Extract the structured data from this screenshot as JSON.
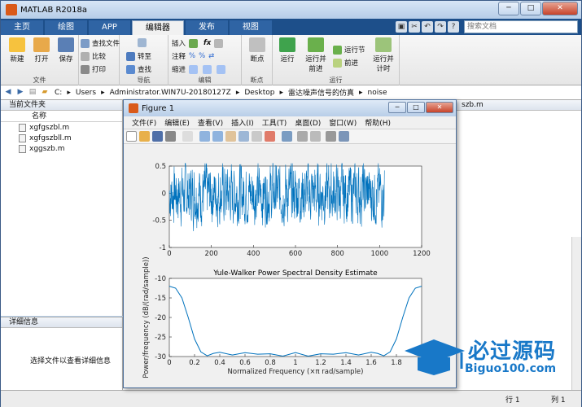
{
  "window": {
    "title": "MATLAB R2018a"
  },
  "tabs": [
    "主页",
    "绘图",
    "APP",
    "编辑器",
    "发布",
    "视图"
  ],
  "search": {
    "placeholder": "搜索文档"
  },
  "toolstrip": {
    "groups": {
      "file": "文件",
      "nav": "导航",
      "edit": "编辑",
      "breakpoints": "断点",
      "run": "运行"
    },
    "new": "新建",
    "open": "打开",
    "save": "保存",
    "find_files": "查找文件",
    "compare": "比较",
    "print": "打印",
    "goto": "转至",
    "find": "查找",
    "insert": "插入",
    "comment": "注释",
    "indent": "缩进",
    "breakpoints": "断点",
    "run": "运行",
    "run_advance": "运行并\n前进",
    "run_section": "运行节",
    "advance": "前进",
    "run_time": "运行并\n计时"
  },
  "address": {
    "parts": [
      "C:",
      "Users",
      "Administrator.WIN7U-20180127Z",
      "Desktop",
      "雷达噪声信号的仿真",
      "noise"
    ]
  },
  "current_folder": {
    "title": "当前文件夹",
    "column": "名称",
    "files": [
      "xgfgszbl.m",
      "xgfgszbll.m",
      "xggszb.m"
    ]
  },
  "details": {
    "title": "详细信息",
    "empty_text": "选择文件以查看详细信息"
  },
  "right_panel": {
    "title": "szb.m"
  },
  "status": {
    "row": "行 1",
    "col": "列 1"
  },
  "figure": {
    "title": "Figure 1",
    "menu": [
      "文件(F)",
      "编辑(E)",
      "查看(V)",
      "插入(I)",
      "工具(T)",
      "桌面(D)",
      "窗口(W)",
      "帮助(H)"
    ]
  },
  "chart_data": [
    {
      "type": "line",
      "title": "",
      "xlabel": "",
      "ylabel": "",
      "xlim": [
        0,
        1200
      ],
      "ylim": [
        -1,
        0.5
      ],
      "xticks": [
        0,
        200,
        400,
        600,
        800,
        1000,
        1200
      ],
      "yticks": [
        -1,
        -0.5,
        0,
        0.5
      ],
      "series": [
        {
          "n_points": 1024,
          "description": "random noise about 0, amplitude approx -0.9 to 0.55",
          "color": "#0072bd"
        }
      ]
    },
    {
      "type": "line",
      "title": "Yule-Walker Power Spectral Density Estimate",
      "xlabel": "Normalized Frequency  (×π rad/sample)",
      "ylabel": "Power/frequency (dB/(rad/sample))",
      "xlim": [
        0,
        2
      ],
      "ylim": [
        -30,
        -10
      ],
      "xticks": [
        0,
        0.2,
        0.4,
        0.6,
        0.8,
        1,
        1.2,
        1.4,
        1.6,
        1.8
      ],
      "yticks": [
        -30,
        -25,
        -20,
        -15,
        -10
      ],
      "series": [
        {
          "x": [
            0,
            0.05,
            0.1,
            0.15,
            0.2,
            0.25,
            0.3,
            0.35,
            0.4,
            0.5,
            0.6,
            0.7,
            0.8,
            0.9,
            1.0,
            1.1,
            1.2,
            1.3,
            1.4,
            1.5,
            1.6,
            1.65,
            1.7,
            1.75,
            1.8,
            1.85,
            1.9,
            1.95,
            2.0
          ],
          "y": [
            -12,
            -12.5,
            -15,
            -20,
            -25.5,
            -28.8,
            -29.8,
            -29.2,
            -28.9,
            -29.6,
            -29.0,
            -29.4,
            -29.3,
            -29.9,
            -29.0,
            -29.9,
            -29.3,
            -29.4,
            -29.0,
            -29.6,
            -28.9,
            -29.2,
            -29.8,
            -28.8,
            -25.5,
            -20,
            -15,
            -12.5,
            -12
          ],
          "color": "#0072bd"
        }
      ]
    }
  ],
  "watermark": {
    "text": "必过源码",
    "url": "Biguo100.com"
  }
}
